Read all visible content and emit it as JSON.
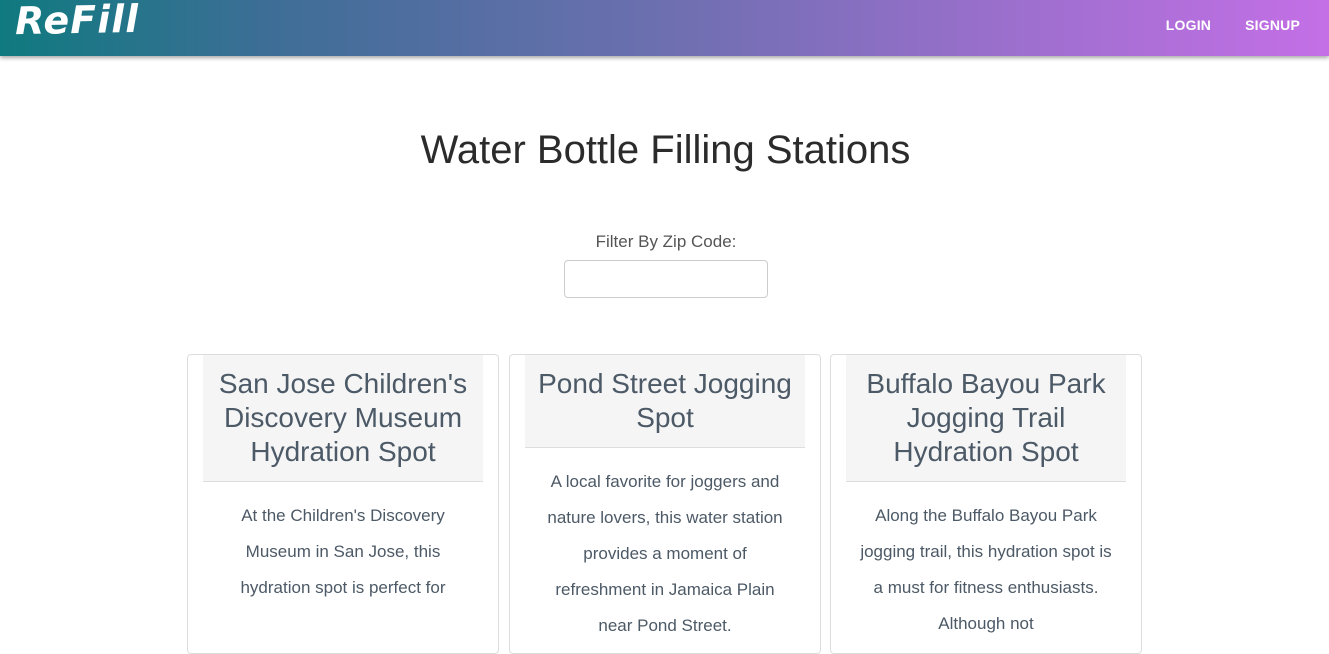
{
  "brand": "ReFill",
  "nav": {
    "login": "LOGIN",
    "signup": "SIGNUP"
  },
  "page_title": "Water Bottle Filling Stations",
  "filter": {
    "label": "Filter By Zip Code:",
    "value": "",
    "placeholder": ""
  },
  "colors": {
    "nav_gradient_start": "#0f7a7f",
    "nav_gradient_end": "#c46fe6",
    "card_header_bg": "#f5f5f5",
    "card_text": "#4c5966"
  },
  "stations": [
    {
      "title": "San Jose Children's Discovery Museum Hydration Spot",
      "description": "At the Children's Discovery Museum in San Jose, this hydration spot is perfect for"
    },
    {
      "title": "Pond Street Jogging Spot",
      "description": "A local favorite for joggers and nature lovers, this water station provides a moment of refreshment in Jamaica Plain near Pond Street."
    },
    {
      "title": "Buffalo Bayou Park Jogging Trail Hydration Spot",
      "description": "Along the Buffalo Bayou Park jogging trail, this hydration spot is a must for fitness enthusiasts. Although not"
    }
  ]
}
